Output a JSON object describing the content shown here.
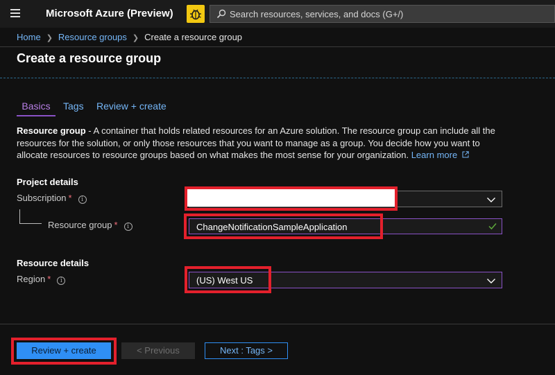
{
  "header": {
    "app_title": "Microsoft Azure (Preview)",
    "search_placeholder": "Search resources, services, and docs (G+/)"
  },
  "breadcrumb": {
    "items": [
      "Home",
      "Resource groups"
    ],
    "current": "Create a resource group"
  },
  "page": {
    "title": "Create a resource group"
  },
  "tabs": [
    {
      "label": "Basics",
      "active": true
    },
    {
      "label": "Tags",
      "active": false
    },
    {
      "label": "Review + create",
      "active": false
    }
  ],
  "description": {
    "term": "Resource group",
    "text": " - A container that holds related resources for an Azure solution. The resource group can include all the resources for the solution, or only those resources that you want to manage as a group. You decide how you want to allocate resources to resource groups based on what makes the most sense for your organization. ",
    "learn_more": "Learn more"
  },
  "project_details": {
    "heading": "Project details",
    "subscription_label": "Subscription",
    "subscription_value": "",
    "resource_group_label": "Resource group",
    "resource_group_value": "ChangeNotificationSampleApplication",
    "required_mark": "*"
  },
  "resource_details": {
    "heading": "Resource details",
    "region_label": "Region",
    "region_value": "(US) West US"
  },
  "footer": {
    "review_create": "Review + create",
    "previous": "< Previous",
    "next": "Next : Tags >"
  },
  "colors": {
    "accent_blue": "#2f8ff5",
    "link_blue": "#75b6f7",
    "purple": "#8a52c7",
    "highlight_red": "#e3202c",
    "required_red": "#f1707b",
    "feedback_yellow": "#f2c811",
    "valid_green": "#5ea93b"
  },
  "icons": [
    "menu-icon",
    "bug-feedback-icon",
    "search-icon",
    "info-icon",
    "chevron-down-icon",
    "checkmark-icon",
    "external-link-icon"
  ]
}
